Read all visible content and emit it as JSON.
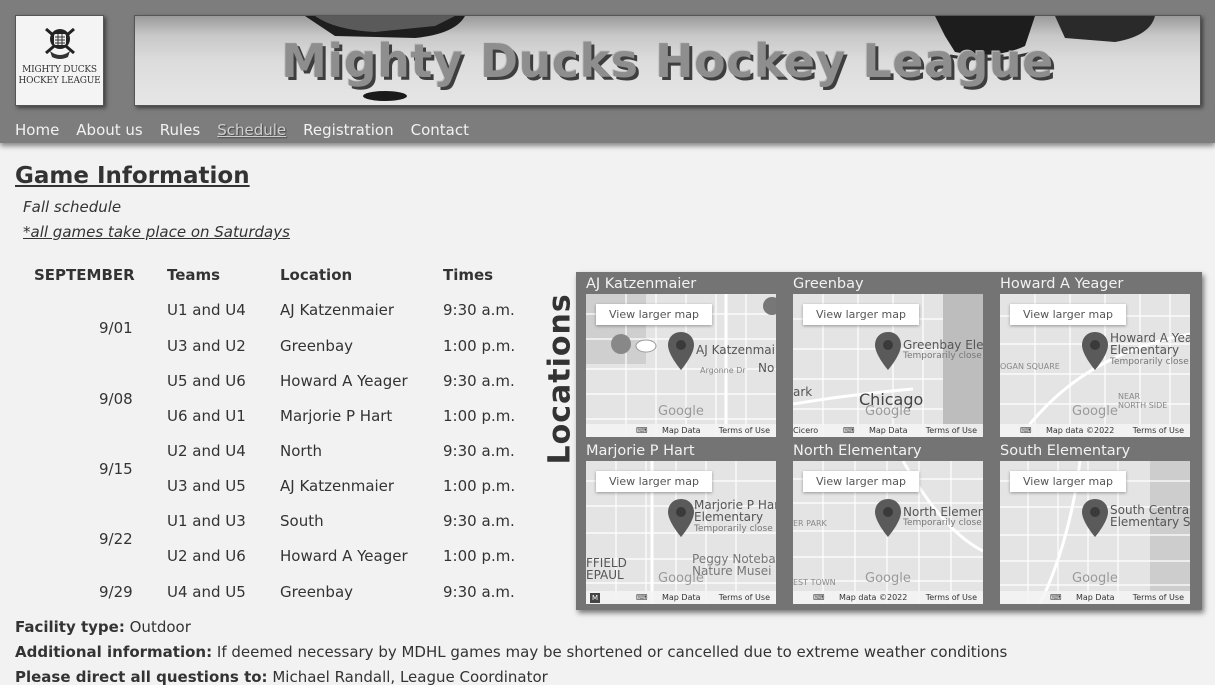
{
  "site": {
    "title": "Mighty Ducks Hockey League",
    "logo_text_line1": "Mighty Ducks",
    "logo_text_line2": "Hockey League"
  },
  "nav": [
    {
      "label": "Home"
    },
    {
      "label": "About us"
    },
    {
      "label": "Rules"
    },
    {
      "label": "Schedule",
      "active": true
    },
    {
      "label": "Registration"
    },
    {
      "label": "Contact"
    }
  ],
  "main": {
    "title": "Game Information",
    "subtitle": "Fall schedule",
    "note": "*all games take place on Saturdays"
  },
  "schedule": {
    "headers": [
      "SEPTEMBER",
      "Teams",
      "Location",
      "Times"
    ],
    "rows": [
      {
        "date": "9/01",
        "teams": "U1 and U4",
        "location": "AJ Katzenmaier",
        "time": "9:30 a.m."
      },
      {
        "date": "",
        "teams": "U3 and U2",
        "location": "Greenbay",
        "time": "1:00 p.m."
      },
      {
        "date": "9/08",
        "teams": "U5 and U6",
        "location": "Howard A Yeager",
        "time": "9:30 a.m."
      },
      {
        "date": "",
        "teams": "U6 and U1",
        "location": "Marjorie P Hart",
        "time": "1:00 p.m."
      },
      {
        "date": "9/15",
        "teams": "U2 and U4",
        "location": "North",
        "time": "9:30 a.m."
      },
      {
        "date": "",
        "teams": "U3 and U5",
        "location": "AJ Katzenmaier",
        "time": "1:00 p.m."
      },
      {
        "date": "9/22",
        "teams": "U1 and U3",
        "location": "South",
        "time": "9:30 a.m."
      },
      {
        "date": "",
        "teams": "U2 and U6",
        "location": "Howard A Yeager",
        "time": "1:00 p.m."
      },
      {
        "date": "9/29",
        "teams": "U4 and U5",
        "location": "Greenbay",
        "time": "9:30 a.m."
      }
    ]
  },
  "locations": {
    "label": "Locations",
    "view_larger": "View larger map",
    "map_data": "Map Data",
    "map_data_2022": "Map data ©2022",
    "terms": "Terms of Use",
    "google": "Google",
    "maps": [
      {
        "name": "AJ Katzenmaier",
        "pin_label": "AJ Katzenmai",
        "pin_sub": "",
        "extra": "Argonne Dr",
        "extra2": "No",
        "city": ""
      },
      {
        "name": "Greenbay",
        "pin_label": "Greenbay Elen",
        "pin_sub": "Temporarily close",
        "extra": "Cicero",
        "extra2": "ark",
        "city": "Chicago"
      },
      {
        "name": "Howard A Yeager",
        "pin_label": "Howard A Yea\nElementary",
        "pin_sub": "Temporarily close",
        "extra": "OGAN SQUARE",
        "extra2": "NEAR NORTH SIDE",
        "city": ""
      },
      {
        "name": "Marjorie P Hart",
        "pin_label": "Marjorie P Har\nElementary",
        "pin_sub": "Temporarily close",
        "extra": "FFIELD EPAUL",
        "extra2": "Peggy Noteba Nature Musei",
        "city": ""
      },
      {
        "name": "North Elementary",
        "pin_label": "North Elemen",
        "pin_sub": "Temporarily close",
        "extra": "ER PARK",
        "extra2": "EST TOWN",
        "city": ""
      },
      {
        "name": "South Elementary",
        "pin_label": "South Central\nElementary Sc",
        "pin_sub": "",
        "extra": "",
        "extra2": "",
        "city": ""
      }
    ]
  },
  "footer": {
    "facility_label": "Facility type:",
    "facility_value": "Outdoor",
    "additional_label": "Additional information:",
    "additional_value": "If deemed necessary by MDHL games may be shortened or cancelled due to extreme weather conditions",
    "questions_label": "Please direct all questions to:",
    "questions_value": "Michael Randall, League Coordinator"
  }
}
